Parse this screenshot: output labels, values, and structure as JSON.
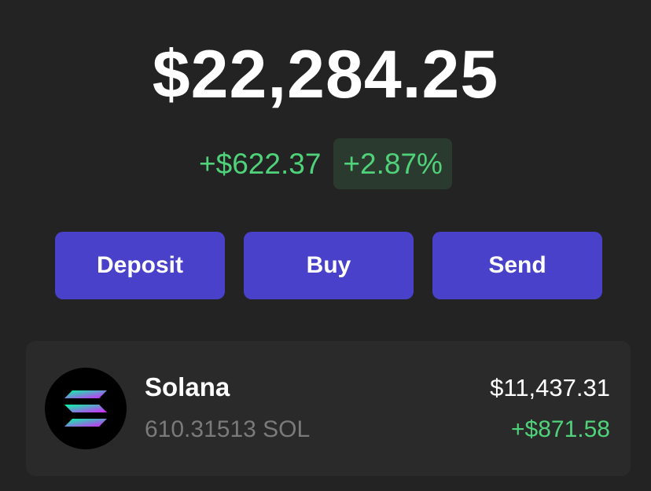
{
  "portfolio": {
    "balance": "$22,284.25",
    "change_amount": "+$622.37",
    "change_percent": "+2.87%"
  },
  "actions": {
    "deposit_label": "Deposit",
    "buy_label": "Buy",
    "send_label": "Send"
  },
  "tokens": [
    {
      "name": "Solana",
      "amount": "610.31513 SOL",
      "value": "$11,437.31",
      "change": "+$871.58",
      "icon": "solana-icon"
    }
  ],
  "colors": {
    "background": "#222322",
    "accent": "#4a41cb",
    "positive": "#4fd27a",
    "card": "#2a2a2a"
  }
}
